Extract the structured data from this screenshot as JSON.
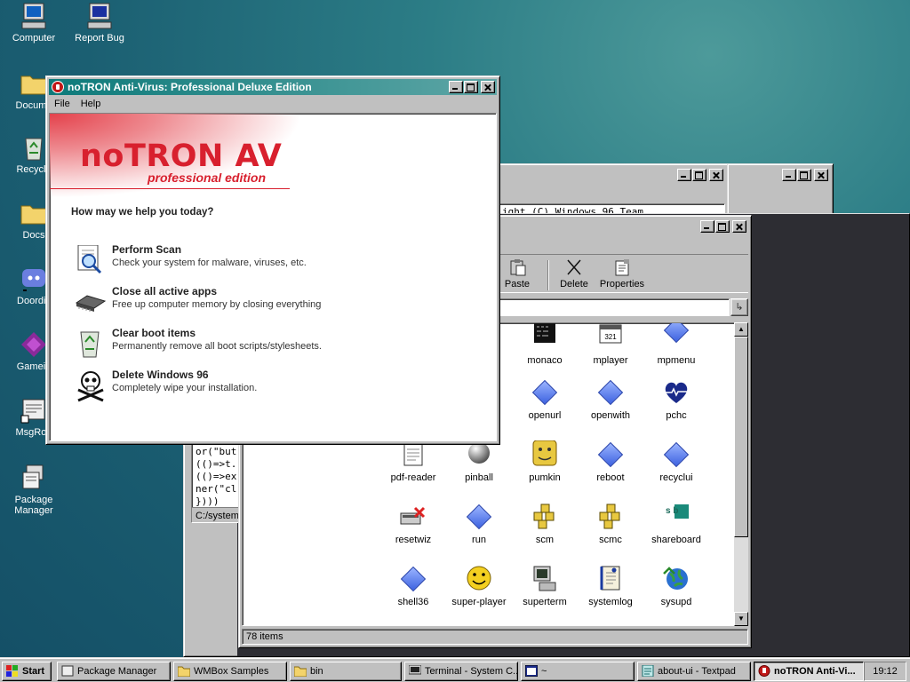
{
  "desktop": {
    "icons": [
      "Computer",
      "Report Bug",
      "Docume",
      "Recycle",
      "Docs",
      "Doordis",
      "Gamein",
      "MsgRoo",
      "Package Manager"
    ]
  },
  "windows": {
    "back1": {
      "partial_text": "ight (C) Windows 96 Team"
    },
    "terminal": {
      "code_lines": [
        "or(\"but",
        "(()=>t.",
        "(()=>ex",
        "ner(\"cl",
        "})))"
      ],
      "status": "C:/system/"
    },
    "filemanager": {
      "toolbar": [
        "Paste",
        "Delete",
        "Properties"
      ],
      "address": "",
      "go_symbol": "↳",
      "files": [
        "monaco",
        "mplayer",
        "mpmenu",
        "openurl",
        "openwith",
        "pchc",
        "pdf-reader",
        "pinball",
        "pumkin",
        "reboot",
        "recyclui",
        "resetwiz",
        "run",
        "scm",
        "scmc",
        "shareboard",
        "shell36",
        "super-player",
        "superterm",
        "systemlog",
        "sysupd"
      ],
      "mplayer_badge": "321",
      "shareboard_badge": "s b",
      "status": "78 items",
      "scroll_up": "▲",
      "scroll_down": "▼"
    },
    "av": {
      "title": "noTRON Anti-Virus: Professional Deluxe Edition",
      "menu": [
        "File",
        "Help"
      ],
      "brand": "noTRON AV",
      "edition": "professional edition",
      "question": "How may we help you today?",
      "actions": [
        {
          "title": "Perform Scan",
          "desc": "Check your system for malware, viruses, etc."
        },
        {
          "title": "Close all active apps",
          "desc": "Free up computer memory by closing everything"
        },
        {
          "title": "Clear boot items",
          "desc": "Permanently remove all boot scripts/stylesheets."
        },
        {
          "title": "Delete Windows 96",
          "desc": "Completely wipe your installation."
        }
      ]
    }
  },
  "taskbar": {
    "start": "Start",
    "items": [
      "Package Manager",
      "WMBox Samples",
      "bin",
      "Terminal - System C...",
      "~",
      "about-ui - Textpad",
      "noTRON Anti-Vi..."
    ],
    "clock": "19:12"
  },
  "colors": {
    "av_red": "#d8202e",
    "active_title": "#0d7a7a",
    "desktop": "#2c7d86"
  }
}
